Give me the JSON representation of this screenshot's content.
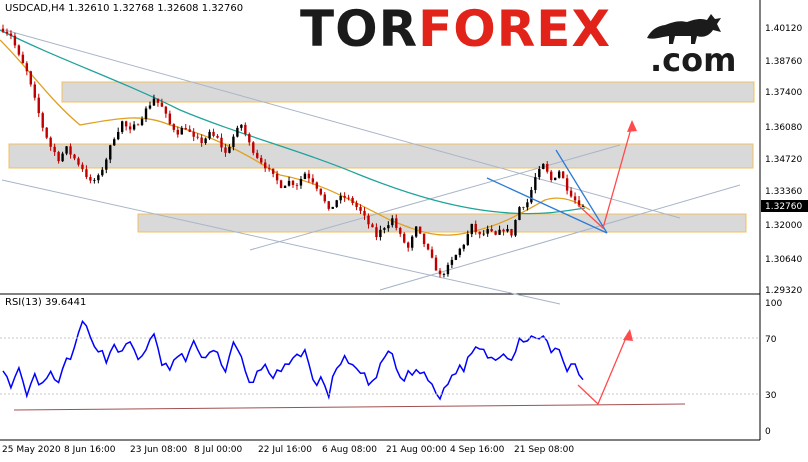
{
  "header": {
    "symbol_info": "USDCAD,H4  1.32610  1.32768  1.32608  1.32760"
  },
  "logo": {
    "part1": "TOR",
    "part2": "FOREX",
    "part3": ".com"
  },
  "rsi_header": "RSI(13) 39.6441",
  "colors": {
    "bull_candle": "#000000",
    "bear_candle": "#c00000",
    "ma_slow": "#20a39b",
    "ma_fast": "#e0a020",
    "rsi": "#0000ff",
    "forecast_arrow": "#ff4b4b",
    "wedge": "#2b7bd8",
    "zone_fill": "#d9d9d9",
    "zone_border": "#f0c060",
    "trend": "#9aa9bf",
    "rsi_support": "#a05050"
  },
  "chart_data": [
    {
      "type": "candlestick",
      "title": "USDCAD,H4",
      "x_tick_labels": [
        "25 May 2020",
        "8 Jun 16:00",
        "23 Jun 08:00",
        "8 Jul 00:00",
        "22 Jul 16:00",
        "6 Aug 08:00",
        "21 Aug 00:00",
        "4 Sep 16:00",
        "21 Sep 08:00"
      ],
      "y_tick_labels": [
        "1.40120",
        "1.38760",
        "1.37400",
        "1.36080",
        "1.34720",
        "1.33360",
        "1.32000",
        "1.30640",
        "1.29320"
      ],
      "ylim": [
        1.2932,
        1.4012
      ],
      "last_price_label": "1.32760",
      "last_price": 1.3276,
      "close_path": [
        [
          0,
          1.4005
        ],
        [
          2,
          1.398
        ],
        [
          4,
          1.389
        ],
        [
          6,
          1.3825
        ],
        [
          8,
          1.371
        ],
        [
          10,
          1.36
        ],
        [
          12,
          1.352
        ],
        [
          14,
          1.347
        ],
        [
          16,
          1.351
        ],
        [
          18,
          1.347
        ],
        [
          20,
          1.343
        ],
        [
          22,
          1.337
        ],
        [
          24,
          1.339
        ],
        [
          26,
          1.347
        ],
        [
          28,
          1.356
        ],
        [
          30,
          1.362
        ],
        [
          32,
          1.358
        ],
        [
          34,
          1.362
        ],
        [
          36,
          1.367
        ],
        [
          38,
          1.372
        ],
        [
          40,
          1.368
        ],
        [
          42,
          1.361
        ],
        [
          44,
          1.358
        ],
        [
          46,
          1.36
        ],
        [
          48,
          1.355
        ],
        [
          50,
          1.354
        ],
        [
          52,
          1.357
        ],
        [
          54,
          1.355
        ],
        [
          56,
          1.349
        ],
        [
          58,
          1.356
        ],
        [
          60,
          1.361
        ],
        [
          62,
          1.353
        ],
        [
          64,
          1.348
        ],
        [
          66,
          1.344
        ],
        [
          68,
          1.3395
        ],
        [
          70,
          1.336
        ],
        [
          72,
          1.3375
        ],
        [
          74,
          1.3365
        ],
        [
          76,
          1.341
        ],
        [
          78,
          1.338
        ],
        [
          80,
          1.333
        ],
        [
          82,
          1.325
        ],
        [
          84,
          1.33
        ],
        [
          86,
          1.331
        ],
        [
          88,
          1.329
        ],
        [
          90,
          1.325
        ],
        [
          92,
          1.32
        ],
        [
          94,
          1.315
        ],
        [
          96,
          1.319
        ],
        [
          98,
          1.322
        ],
        [
          100,
          1.315
        ],
        [
          102,
          1.31
        ],
        [
          104,
          1.318
        ],
        [
          106,
          1.312
        ],
        [
          108,
          1.305
        ],
        [
          110,
          1.2985
        ],
        [
          112,
          1.302
        ],
        [
          114,
          1.307
        ],
        [
          116,
          1.312
        ],
        [
          118,
          1.319
        ],
        [
          120,
          1.315
        ],
        [
          122,
          1.317
        ],
        [
          124,
          1.315
        ],
        [
          126,
          1.318
        ],
        [
          128,
          1.316
        ],
        [
          130,
          1.327
        ],
        [
          132,
          1.329
        ],
        [
          134,
          1.339
        ],
        [
          136,
          1.344
        ],
        [
          138,
          1.338
        ],
        [
          140,
          1.342
        ],
        [
          142,
          1.335
        ],
        [
          144,
          1.33
        ],
        [
          146,
          1.327
        ]
      ],
      "annotations": [
        "support/resistance zones",
        "trend lines",
        "falling wedge",
        "forecast arrow"
      ]
    },
    {
      "type": "line",
      "title": "RSI(13) 39.6441",
      "y_tick_labels": [
        "100",
        "70",
        "30",
        "0"
      ],
      "ylim": [
        0,
        100
      ],
      "levels": [
        30,
        70
      ],
      "current_value": 39.6441,
      "path": [
        [
          0,
          50
        ],
        [
          2,
          31
        ],
        [
          4,
          46
        ],
        [
          6,
          26
        ],
        [
          8,
          42
        ],
        [
          10,
          34
        ],
        [
          12,
          44
        ],
        [
          14,
          36
        ],
        [
          16,
          55
        ],
        [
          18,
          62
        ],
        [
          20,
          86
        ],
        [
          22,
          72
        ],
        [
          24,
          65
        ],
        [
          26,
          55
        ],
        [
          28,
          68
        ],
        [
          30,
          60
        ],
        [
          32,
          70
        ],
        [
          34,
          55
        ],
        [
          36,
          65
        ],
        [
          38,
          73
        ],
        [
          40,
          53
        ],
        [
          42,
          48
        ],
        [
          44,
          58
        ],
        [
          46,
          56
        ],
        [
          48,
          70
        ],
        [
          50,
          54
        ],
        [
          52,
          64
        ],
        [
          54,
          60
        ],
        [
          56,
          47
        ],
        [
          58,
          67
        ],
        [
          60,
          56
        ],
        [
          62,
          36
        ],
        [
          64,
          44
        ],
        [
          66,
          52
        ],
        [
          68,
          42
        ],
        [
          70,
          46
        ],
        [
          72,
          51
        ],
        [
          74,
          57
        ],
        [
          76,
          65
        ],
        [
          78,
          37
        ],
        [
          80,
          40
        ],
        [
          82,
          28
        ],
        [
          84,
          50
        ],
        [
          86,
          58
        ],
        [
          88,
          48
        ],
        [
          90,
          48
        ],
        [
          92,
          35
        ],
        [
          94,
          40
        ],
        [
          96,
          58
        ],
        [
          98,
          60
        ],
        [
          100,
          38
        ],
        [
          102,
          45
        ],
        [
          104,
          44
        ],
        [
          106,
          46
        ],
        [
          108,
          33
        ],
        [
          110,
          25
        ],
        [
          112,
          38
        ],
        [
          114,
          47
        ],
        [
          116,
          49
        ],
        [
          118,
          62
        ],
        [
          120,
          66
        ],
        [
          122,
          60
        ],
        [
          124,
          56
        ],
        [
          126,
          62
        ],
        [
          128,
          56
        ],
        [
          130,
          72
        ],
        [
          132,
          67
        ],
        [
          134,
          76
        ],
        [
          136,
          74
        ],
        [
          138,
          60
        ],
        [
          140,
          62
        ],
        [
          142,
          48
        ],
        [
          144,
          50
        ],
        [
          146,
          39.6441
        ]
      ]
    }
  ]
}
